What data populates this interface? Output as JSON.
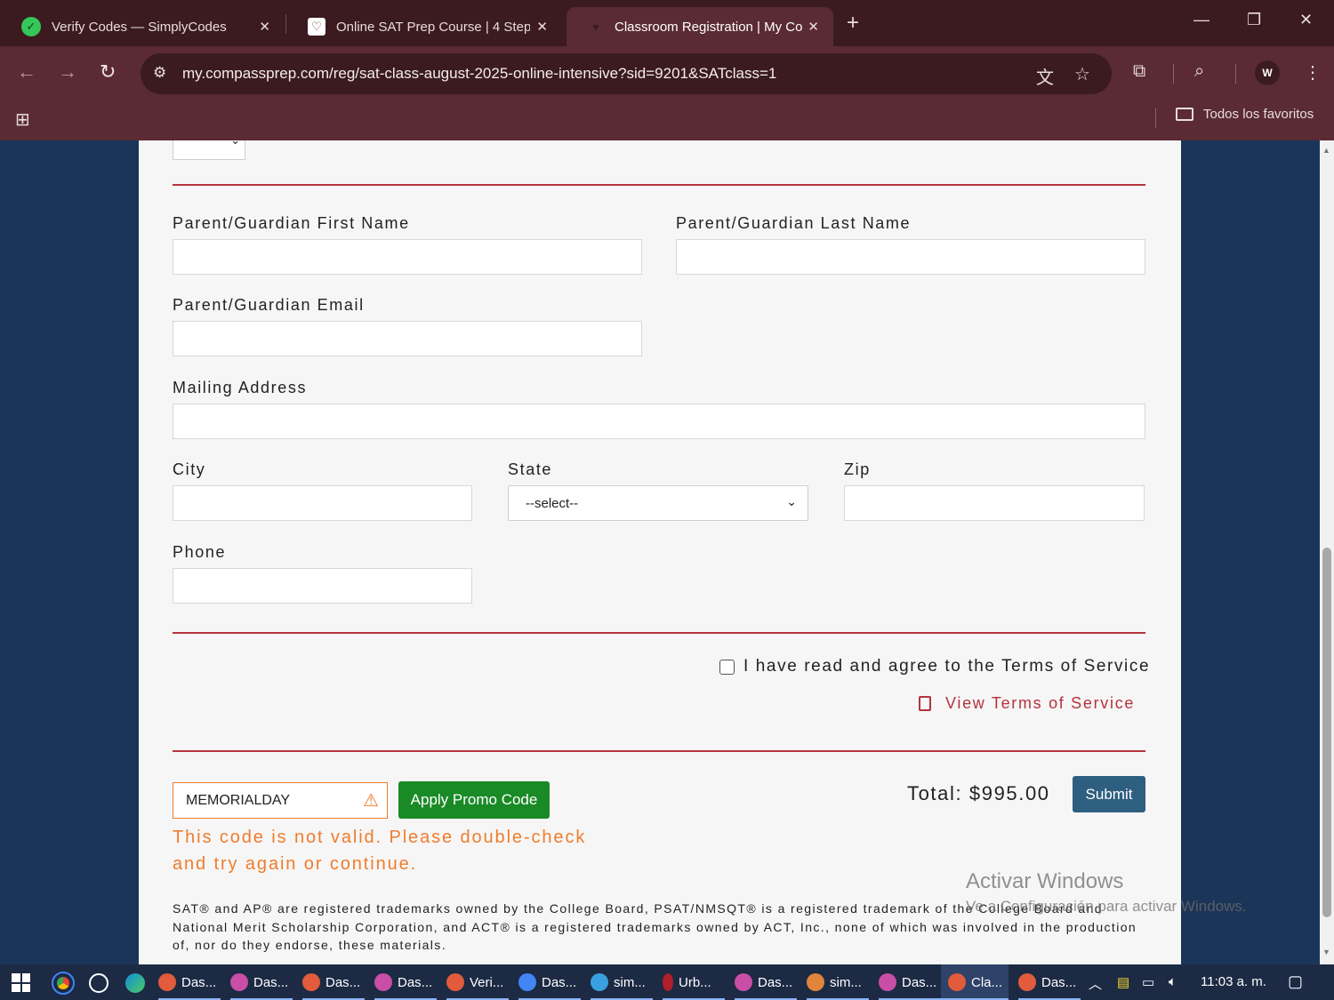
{
  "browser": {
    "tabs": [
      {
        "title": "Verify Codes — SimplyCodes",
        "icon": "simplycodes-favicon",
        "color": "#34c759"
      },
      {
        "title": "Online SAT Prep Course | 4 Step",
        "icon": "compass-favicon",
        "color": "#ffffff"
      },
      {
        "title": "Classroom Registration | My Co",
        "icon": "compass-favicon",
        "color": "#5a2b33"
      }
    ],
    "url": "my.compassprep.com/reg/sat-class-august-2025-online-intensive?sid=9201&SATclass=1",
    "avatar_letter": "W",
    "bookmarks_folder": "Todos los favoritos",
    "accent_color": "#5a2b33"
  },
  "form": {
    "parent_first_name_label": "Parent/Guardian First Name",
    "parent_last_name_label": "Parent/Guardian Last Name",
    "parent_email_label": "Parent/Guardian Email",
    "mailing_address_label": "Mailing Address",
    "city_label": "City",
    "state_label": "State",
    "state_value": "--select--",
    "zip_label": "Zip",
    "phone_label": "Phone",
    "tos_checkbox_label": "I have read and agree to the Terms of Service",
    "tos_link": "View Terms of Service",
    "promo_code_value": "MEMORIALDAY",
    "apply_promo_label": "Apply Promo Code",
    "promo_error": "This code is not valid. Please double-check and try again or continue.",
    "total": "Total: $995.00",
    "submit_label": "Submit",
    "disclaimer": "SAT® and AP® are registered trademarks owned by the College Board, PSAT/NMSQT® is a registered trademark of the College Board and National Merit Scholarship Corporation, and ACT® is a registered trademarks owned by ACT, Inc., none of which was involved in the production of, nor do they endorse, these materials.",
    "divider_color": "#b5323c",
    "error_color": "#f07c2c",
    "promo_button_color": "#1a8a26",
    "submit_button_color": "#2f5f80"
  },
  "watermark": {
    "title": "Activar Windows",
    "subtitle": "Ve a Configuración para activar Windows."
  },
  "taskbar": {
    "items": [
      "Das...",
      "Das...",
      "Das...",
      "Das...",
      "Veri...",
      "Das...",
      "sim...",
      "Urb...",
      "Das...",
      "sim...",
      "Das...",
      "Cla...",
      "Das..."
    ],
    "clock": "11:03 a. m."
  }
}
